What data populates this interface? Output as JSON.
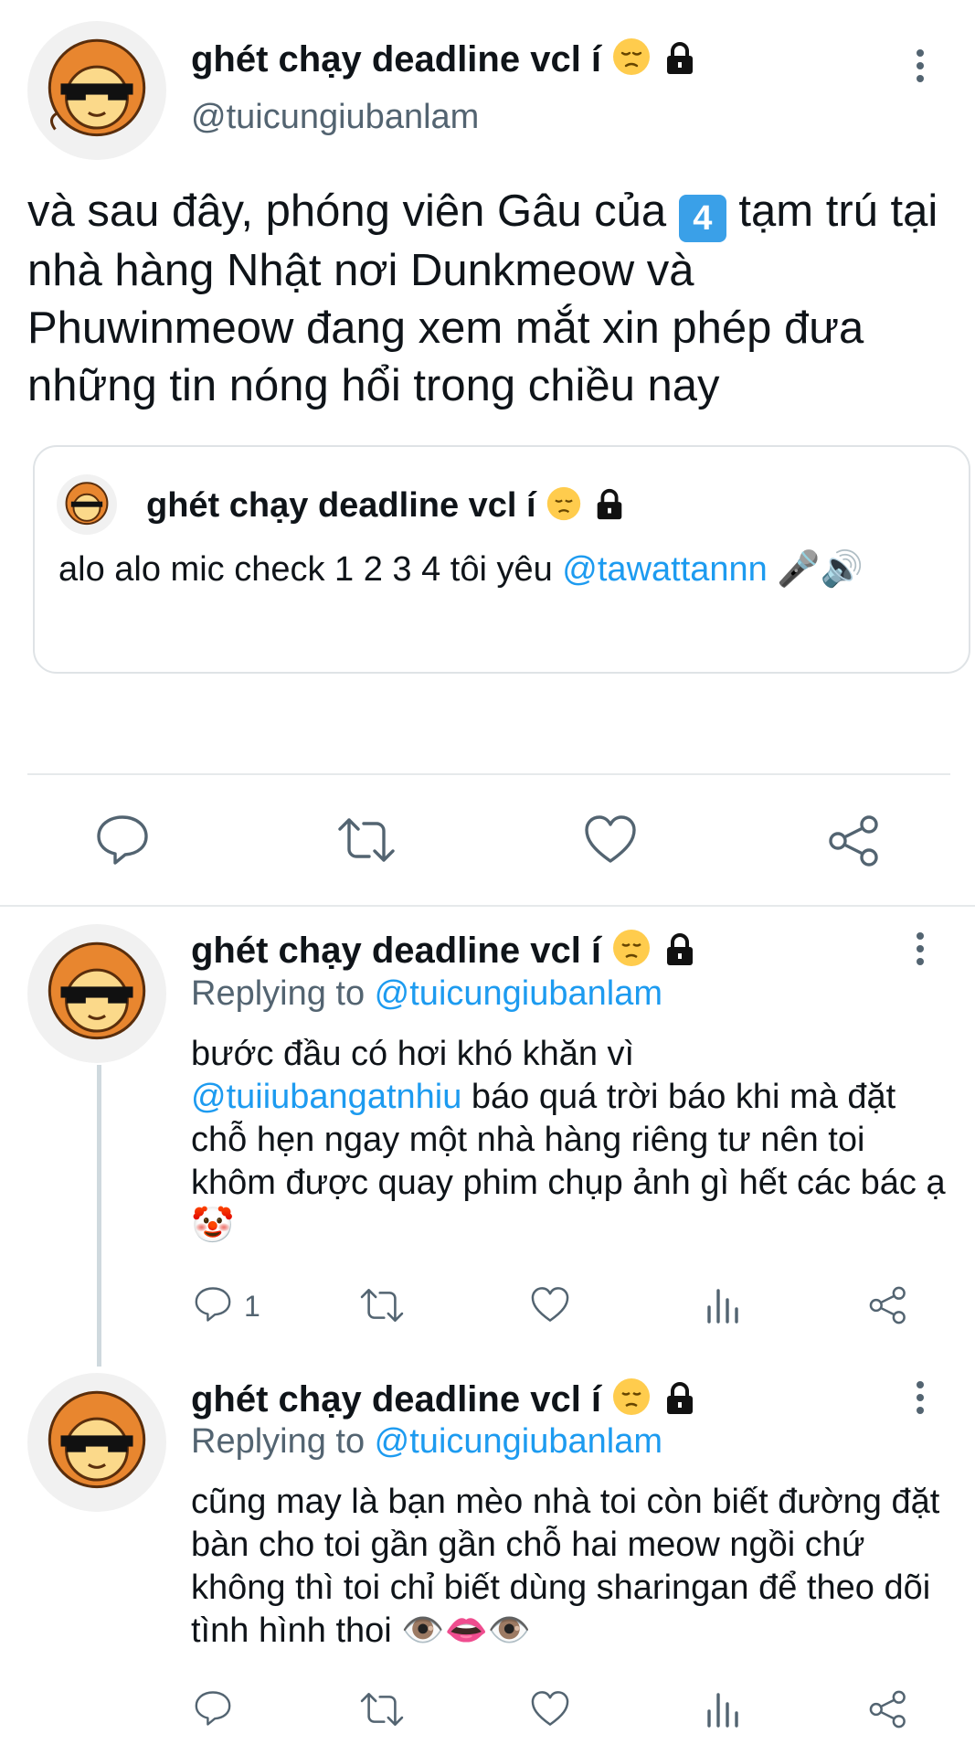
{
  "main_tweet": {
    "display_name": "ghét chạy deadline vcl í",
    "handle": "@tuicungiubanlam",
    "text_before_keycap": "và sau đây, phóng viên Gâu của ",
    "keycap": "4",
    "text_after_keycap": " tạm trú tại nhà hàng Nhật nơi Dunkmeow và Phuwinmeow đang xem mắt xin phép đưa những tin nóng hổi trong chiều nay",
    "quoted": {
      "display_name": "ghét chạy deadline vcl í",
      "text_before_mention": "alo alo mic check 1 2 3 4 tôi yêu ",
      "mention": "@tawattannn",
      "text_after_mention": " 🎤🔊"
    },
    "actions": [
      "reply-icon",
      "retweet-icon",
      "like-icon",
      "share-icon"
    ]
  },
  "replies": [
    {
      "display_name": "ghét chạy deadline vcl í",
      "replying_prefix": "Replying to ",
      "replying_to": "@tuicungiubanlam",
      "text_line1": "bước đầu có hơi khó khăn vì",
      "mention": "@tuiiubangatnhiu",
      "text_after_mention": " báo quá trời báo khi mà đặt chỗ hẹn ngay một nhà hàng riêng tư nên toi khôm được quay phim chụp ảnh gì hết các bác ạ 🤡",
      "reply_count": "1"
    },
    {
      "display_name": "ghét chạy deadline vcl í",
      "replying_prefix": "Replying to ",
      "replying_to": "@tuicungiubanlam",
      "text": "cũng may là bạn mèo nhà toi còn biết đường đặt bàn cho toi gần gần chỗ hai meow ngồi chứ không thì toi chỉ biết dùng sharingan để theo dõi tình hình thoi 👁️👄👁️"
    }
  ],
  "name_suffix": "😔",
  "colors": {
    "link": "#1d9bf0",
    "secondary": "#536471",
    "divider": "#e6e9eb"
  }
}
